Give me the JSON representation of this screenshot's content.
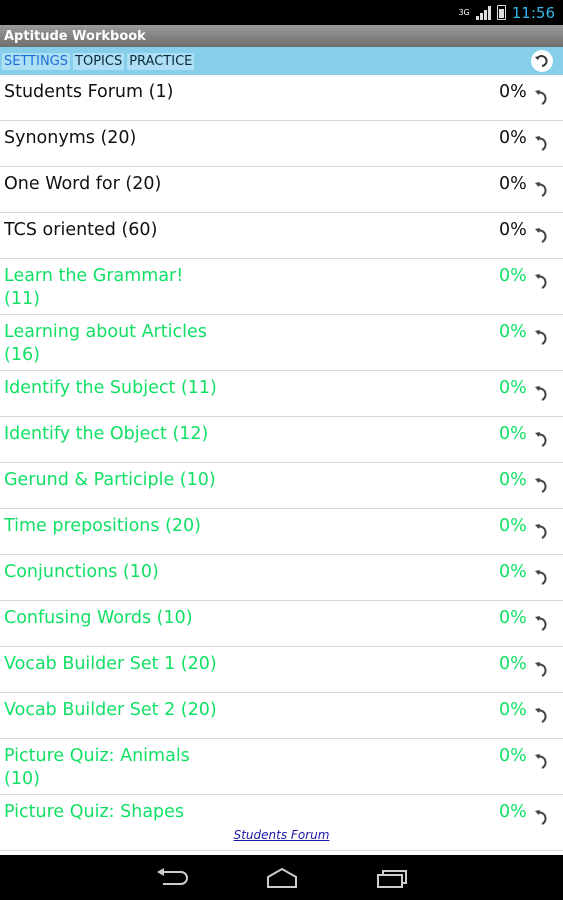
{
  "status_bar": {
    "network": "3G",
    "time": "11:56"
  },
  "app": {
    "title": "Aptitude Workbook"
  },
  "tabs": [
    {
      "label": "SETTINGS",
      "active": true
    },
    {
      "label": "TOPICS",
      "active": false
    },
    {
      "label": "PRACTICE",
      "active": false
    }
  ],
  "list": [
    {
      "label": "Students Forum (1)",
      "percent": "0%",
      "color": "black",
      "h": 46
    },
    {
      "label": "Synonyms (20)",
      "percent": "0%",
      "color": "black",
      "h": 46
    },
    {
      "label": "One Word for (20)",
      "percent": "0%",
      "color": "black",
      "h": 46
    },
    {
      "label": "TCS oriented (60)",
      "percent": "0%",
      "color": "black",
      "h": 46
    },
    {
      "label": "Learn the Grammar! (11)",
      "percent": "0%",
      "color": "green",
      "h": 56
    },
    {
      "label": "Learning about Articles (16)",
      "percent": "0%",
      "color": "green",
      "h": 56
    },
    {
      "label": "Identify the Subject (11)",
      "percent": "0%",
      "color": "green",
      "h": 46
    },
    {
      "label": "Identify the Object (12)",
      "percent": "0%",
      "color": "green",
      "h": 46
    },
    {
      "label": "Gerund & Participle (10)",
      "percent": "0%",
      "color": "green",
      "h": 46
    },
    {
      "label": "Time prepositions (20)",
      "percent": "0%",
      "color": "green",
      "h": 46
    },
    {
      "label": "Conjunctions (10)",
      "percent": "0%",
      "color": "green",
      "h": 46
    },
    {
      "label": "Confusing Words (10)",
      "percent": "0%",
      "color": "green",
      "h": 46
    },
    {
      "label": "Vocab Builder Set 1 (20)",
      "percent": "0%",
      "color": "green",
      "h": 46
    },
    {
      "label": "Vocab Builder Set 2 (20)",
      "percent": "0%",
      "color": "green",
      "h": 46
    },
    {
      "label": "Picture Quiz: Animals (10)",
      "percent": "0%",
      "color": "green",
      "h": 56
    },
    {
      "label": "Picture Quiz: Shapes",
      "percent": "0%",
      "color": "green",
      "h": 56
    }
  ],
  "footer": {
    "link": "Students Forum"
  },
  "colors": {
    "tab_bar": "#87ceeb",
    "green_text": "#12e065",
    "status_time": "#33b5e5"
  }
}
